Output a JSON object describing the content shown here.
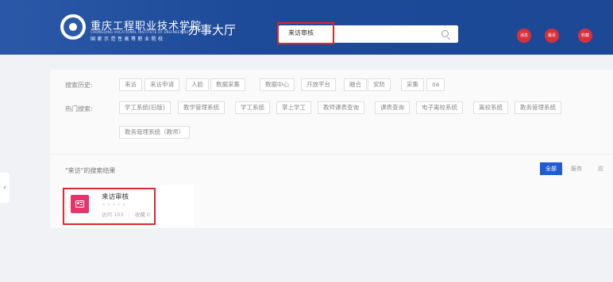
{
  "header": {
    "school_name": "重庆工程职业技术学院",
    "school_name_en": "CHONGQING VOCATIONAL INSTITUTE OF ENGINEERING",
    "school_subtitle": "国家示范性高等职业院校",
    "title": "办事大厅",
    "buttons": [
      {
        "label": "消息"
      },
      {
        "label": "最近"
      },
      {
        "label": "收藏"
      }
    ]
  },
  "search": {
    "value": "来访审核"
  },
  "history": {
    "label": "搜索历史:",
    "tags": [
      "来访",
      "来访申请",
      "人脸",
      "数据采集",
      "数据中心",
      "开放平台",
      "融合",
      "安防",
      "采集",
      "oa"
    ]
  },
  "hot": {
    "label": "热门搜索:",
    "tags": [
      "学工系统(旧版)",
      "教学管理系统",
      "学工系统",
      "掌上学工",
      "教师课表查询",
      "课表查询",
      "电子离校系统",
      "离校系统",
      "教务管理系统",
      "教务管理系统（教师）"
    ]
  },
  "results": {
    "title": "\"来访\"的搜索结果",
    "tabs": [
      "全部",
      "服务",
      "应"
    ],
    "items": [
      {
        "name": "来访审核",
        "stars": "★★★★★",
        "visits": "访问 103",
        "favorites": "收藏 0"
      }
    ]
  },
  "side_tab": {
    "label": "‹"
  },
  "colors": {
    "header_bg": "#1d4a99",
    "accent_red": "#d9313a",
    "tab_active": "#1e5bd5",
    "app_icon": "#e6336a",
    "highlight_box": "#e0262c"
  }
}
